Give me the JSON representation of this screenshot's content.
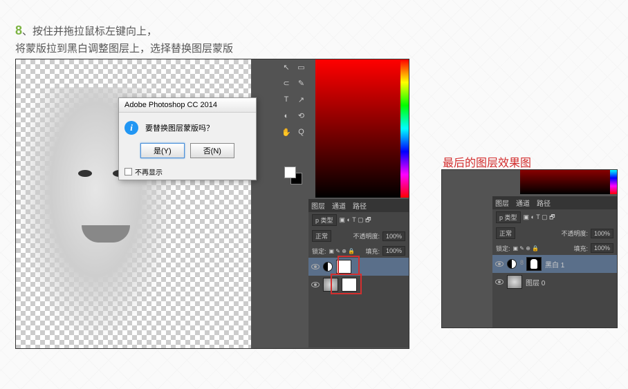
{
  "step": {
    "number": "8",
    "line1": "、按住并拖拉鼠标左键向上，",
    "line2": "将蒙版拉到黑白调整图层上，选择替换图层蒙版"
  },
  "dialog": {
    "title": "Adobe Photoshop CC 2014",
    "message": "要替换图层蒙版吗？",
    "yes": "是(Y)",
    "no": "否(N)",
    "dontshow": "不再显示"
  },
  "panels": {
    "tabs": {
      "layers": "图层",
      "channels": "通道",
      "paths": "路径"
    },
    "kind": "p 类型",
    "blend": "正常",
    "opacity_label": "不透明度:",
    "opacity": "100%",
    "lock_label": "锁定:",
    "fill_label": "填充:",
    "fill": "100%"
  },
  "layers": {
    "bw": "黑白 1",
    "bg": "图层 0"
  },
  "right_label": "最后的图层效果图",
  "tools": [
    "↖",
    "▭",
    "⊂",
    "✎",
    "T",
    "↗",
    "◐",
    "⟲",
    "✋",
    "Q",
    "↔",
    "⊕"
  ],
  "lock_icons": "图 ✎ ⊕ 🔒"
}
